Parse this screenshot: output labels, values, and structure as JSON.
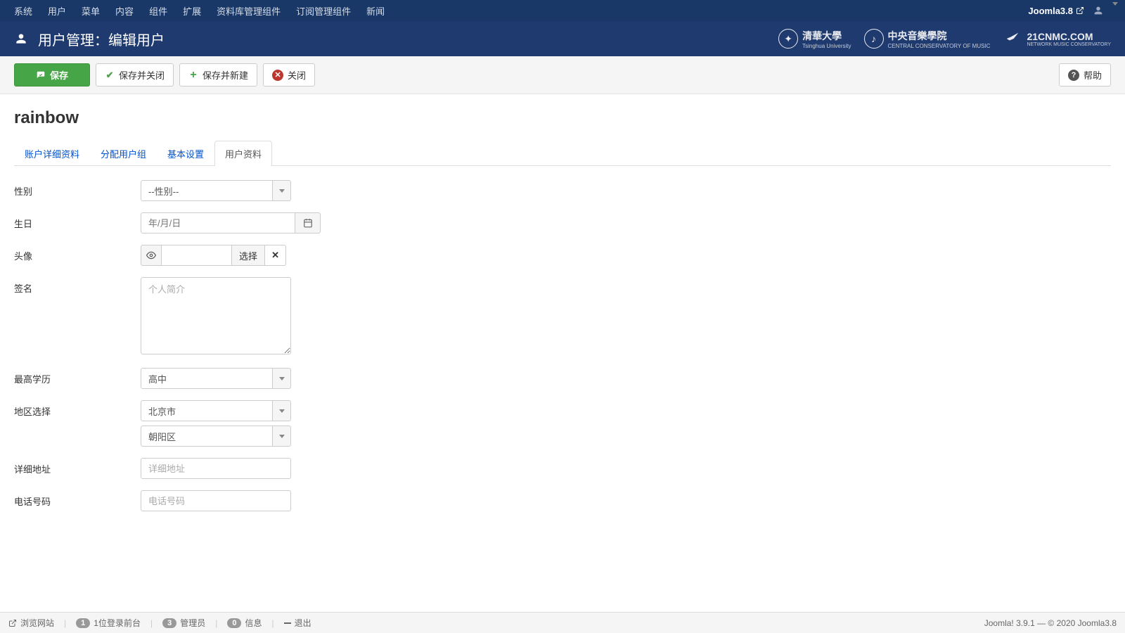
{
  "topnav": {
    "items": [
      "系统",
      "用户",
      "菜单",
      "内容",
      "组件",
      "扩展",
      "资料库管理组件",
      "订阅管理组件",
      "新闻"
    ],
    "site_name": "Joomla3.8"
  },
  "header": {
    "title": "用户管理：编辑用户",
    "logos": [
      {
        "main": "清華大學",
        "sub": "Tsinghua University"
      },
      {
        "main": "中央音樂學院",
        "sub": "CENTRAL CONSERVATORY OF MUSIC"
      },
      {
        "main": "21CNMC.COM",
        "sub": "NETWORK MUSIC CONSERVATORY"
      }
    ]
  },
  "toolbar": {
    "save": "保存",
    "save_close": "保存并关闭",
    "save_new": "保存并新建",
    "close": "关闭",
    "help": "帮助"
  },
  "page": {
    "subtitle": "rainbow"
  },
  "tabs": [
    {
      "label": "账户详细资料",
      "active": false
    },
    {
      "label": "分配用户组",
      "active": false
    },
    {
      "label": "基本设置",
      "active": false
    },
    {
      "label": "用户资料",
      "active": true
    }
  ],
  "form": {
    "gender": {
      "label": "性别",
      "value": "--性别--"
    },
    "birthday": {
      "label": "生日",
      "placeholder": "年/月/日"
    },
    "avatar": {
      "label": "头像",
      "select_btn": "选择"
    },
    "signature": {
      "label": "签名",
      "placeholder": "个人简介"
    },
    "education": {
      "label": "最高学历",
      "value": "高中"
    },
    "region": {
      "label": "地区选择",
      "province": "北京市",
      "district": "朝阳区"
    },
    "address": {
      "label": "详细地址",
      "placeholder": "详细地址"
    },
    "phone": {
      "label": "电话号码",
      "placeholder": "电话号码"
    }
  },
  "footer": {
    "view_site": "浏览网站",
    "logged_in": {
      "count": "1",
      "label": "1位登录前台"
    },
    "admins": {
      "count": "3",
      "label": "管理员"
    },
    "messages": {
      "count": "0",
      "label": "信息"
    },
    "logout": "退出",
    "right": "Joomla! 3.9.1 — © 2020 Joomla3.8"
  }
}
